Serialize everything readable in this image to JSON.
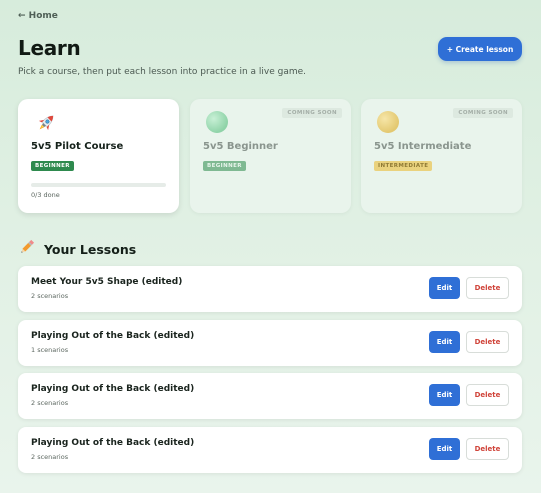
{
  "nav": {
    "back_label": "← Home"
  },
  "header": {
    "title": "Learn",
    "subtitle": "Pick a course, then put each lesson into practice in a live game.",
    "create_label": "+ Create lesson"
  },
  "courses": [
    {
      "icon": "rocket-icon",
      "title": "5v5 Pilot Course",
      "level": "BEGINNER",
      "progress_text": "0/3 done",
      "progress_fraction": 0,
      "status": ""
    },
    {
      "icon": "green-ball-icon",
      "title": "5v5 Beginner",
      "level": "BEGINNER",
      "status": "COMING SOON"
    },
    {
      "icon": "yellow-ball-icon",
      "title": "5v5 Intermediate",
      "level": "INTERMEDIATE",
      "status": "COMING SOON"
    }
  ],
  "lessons_section": {
    "icon": "pencil-icon",
    "title": "Your Lessons"
  },
  "lessons": [
    {
      "title": "Meet Your 5v5 Shape (edited)",
      "meta": "2 scenarios",
      "edit_label": "Edit",
      "delete_label": "Delete"
    },
    {
      "title": "Playing Out of the Back (edited)",
      "meta": "1 scenarios",
      "edit_label": "Edit",
      "delete_label": "Delete"
    },
    {
      "title": "Playing Out of the Back (edited)",
      "meta": "2 scenarios",
      "edit_label": "Edit",
      "delete_label": "Delete"
    },
    {
      "title": "Playing Out of the Back (edited)",
      "meta": "2 scenarios",
      "edit_label": "Edit",
      "delete_label": "Delete"
    }
  ],
  "colors": {
    "primary_button": "#2f6fd6",
    "beginner_badge_active": "#2e8a4e",
    "beginner_badge_muted": "#7fb992",
    "intermediate_badge": "#ead27e",
    "delete_text": "#d0443a"
  }
}
